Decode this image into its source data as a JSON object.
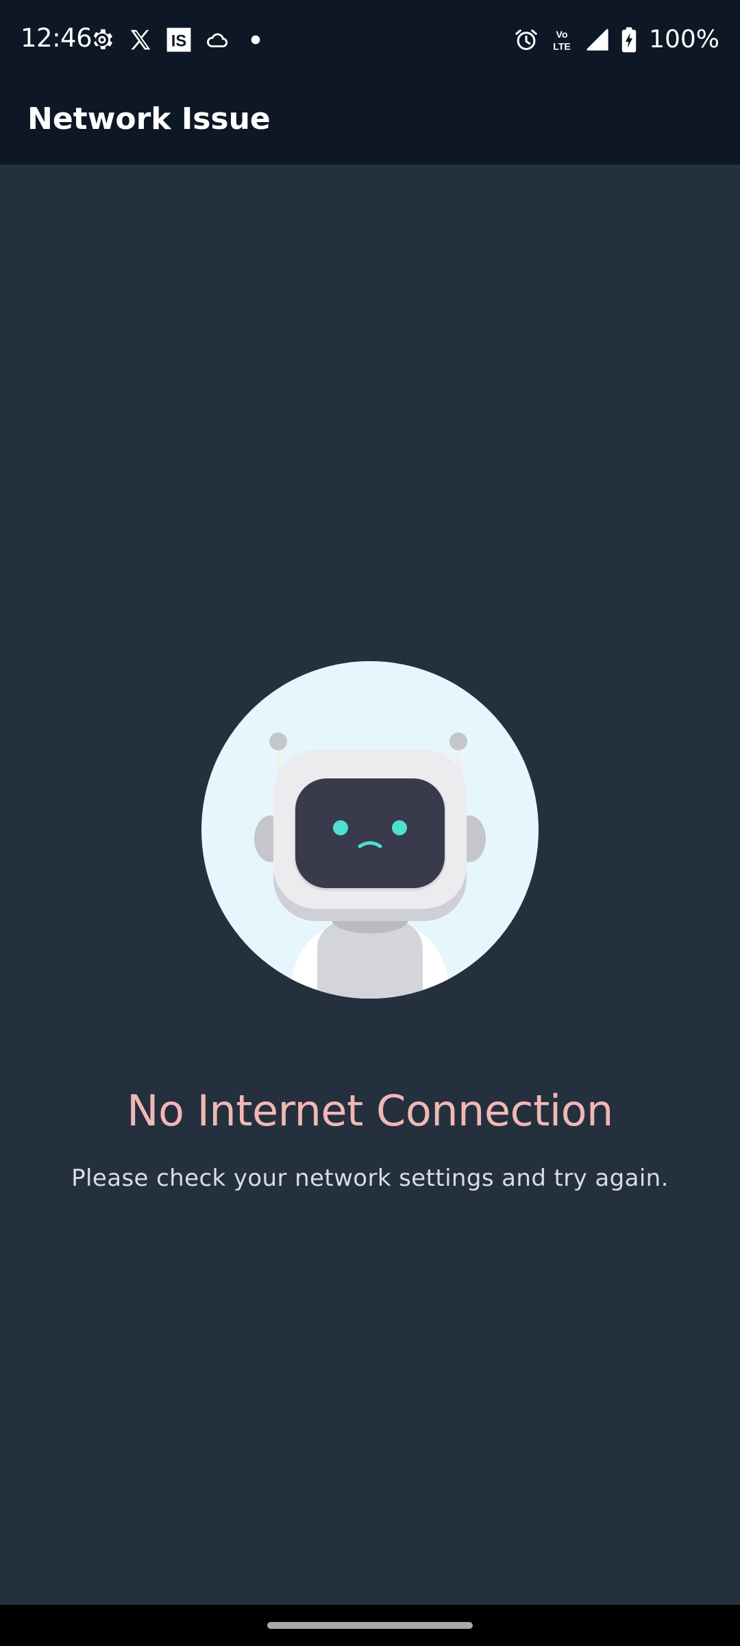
{
  "status_bar": {
    "time": "12:46",
    "battery": "100%",
    "left_icons": [
      "settings-gear-icon",
      "x-app-icon",
      "is-app-icon",
      "weather-cloud-icon",
      "notification-dot-icon"
    ],
    "right_icons": [
      "alarm-icon",
      "volte-icon",
      "signal-icon",
      "battery-charging-icon"
    ],
    "volte_line1": "Vo",
    "volte_line2": "LTE",
    "is_badge": "IS"
  },
  "app_bar": {
    "title": "Network Issue"
  },
  "illustration": {
    "icon": "sad-robot-icon",
    "colors": {
      "circle": "#e7f6fd",
      "head": "#ececee",
      "face": "#393b4d",
      "eyes": "#4fe0d0",
      "body": "#d4d5db"
    }
  },
  "message": {
    "headline": "No Internet Connection",
    "subtext": "Please check your network settings and try again."
  },
  "colors": {
    "background": "#24303e",
    "app_bar": "#0e1726",
    "headline": "#f1b7b6",
    "subtext": "#d9dde3"
  }
}
